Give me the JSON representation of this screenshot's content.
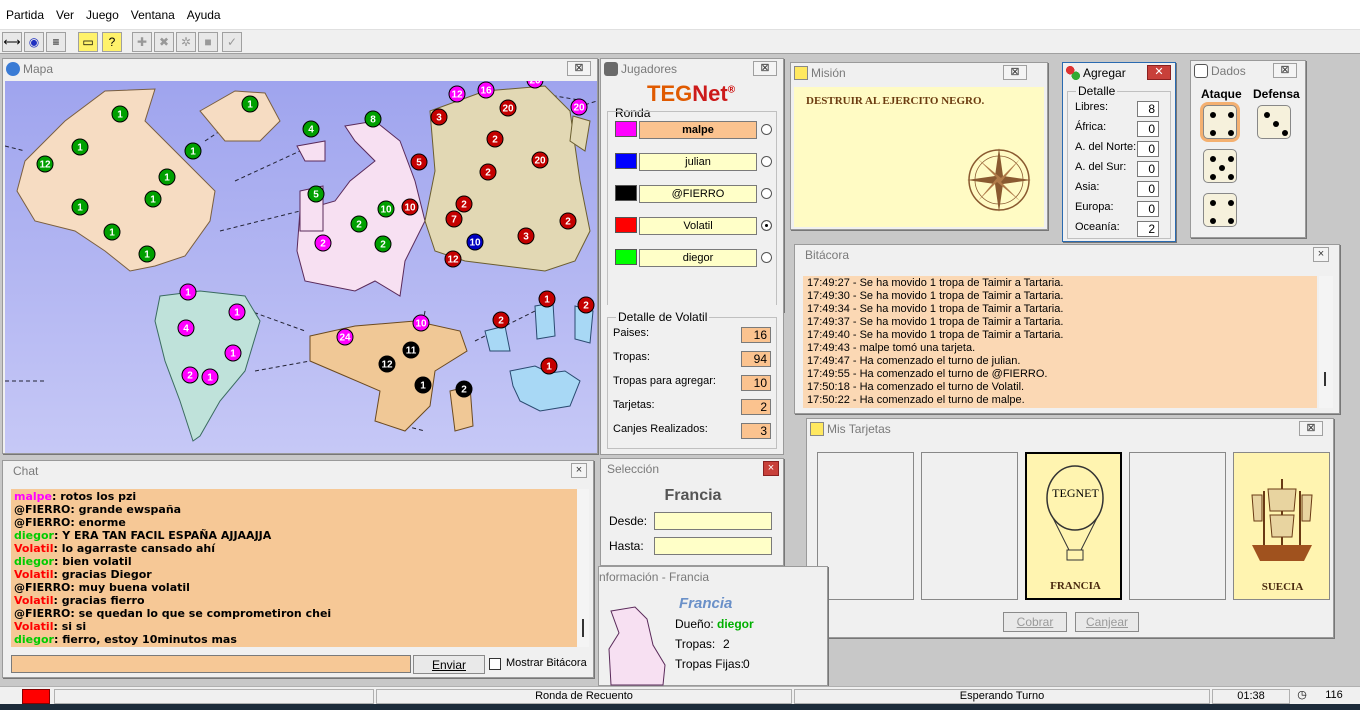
{
  "menu": [
    "Partida",
    "Ver",
    "Juego",
    "Ventana",
    "Ayuda"
  ],
  "toolbar_icons": [
    "connect-icon",
    "globe-icon",
    "list-icon",
    "note-icon",
    "help-icon",
    "plus-icon",
    "cross-icon",
    "gear-icon",
    "block-icon",
    "check-icon"
  ],
  "mapa": {
    "title": "Mapa",
    "close": "⊠"
  },
  "players": {
    "title": "Jugadores",
    "logo_a": "TEG",
    "logo_b": "Net",
    "logo_reg": "®",
    "ronda_label": "Ronda",
    "list": [
      {
        "name": "malpe",
        "color": "#ff00ff",
        "selected": false,
        "active": true
      },
      {
        "name": "julian",
        "color": "#0000ff",
        "selected": false,
        "active": false
      },
      {
        "name": "@FIERRO",
        "color": "#000000",
        "selected": false,
        "active": false
      },
      {
        "name": "Volatil",
        "color": "#ff0000",
        "selected": true,
        "active": false
      },
      {
        "name": "diegor",
        "color": "#00ff00",
        "selected": false,
        "active": false
      }
    ],
    "detail": {
      "title": "Detalle de Volatil",
      "rows": [
        {
          "label": "Paises:",
          "value": "16"
        },
        {
          "label": "Tropas:",
          "value": "94"
        },
        {
          "label": "Tropas para agregar:",
          "value": "10"
        },
        {
          "label": "Tarjetas:",
          "value": "2"
        },
        {
          "label": "Canjes Realizados:",
          "value": "3"
        }
      ]
    }
  },
  "mision": {
    "title": "Misión",
    "text": "DESTRUIR AL EJERCITO NEGRO."
  },
  "agregar": {
    "title": "Agregar",
    "group": "Detalle",
    "rows": [
      {
        "label": "Libres:",
        "value": "8"
      },
      {
        "label": "África:",
        "value": "0"
      },
      {
        "label": "A. del Norte:",
        "value": "0"
      },
      {
        "label": "A. del Sur:",
        "value": "0"
      },
      {
        "label": "Asia:",
        "value": "0"
      },
      {
        "label": "Europa:",
        "value": "0"
      },
      {
        "label": "Oceanía:",
        "value": "2"
      }
    ]
  },
  "dados": {
    "title": "Dados",
    "ataque": "Ataque",
    "defensa": "Defensa",
    "attack": [
      4,
      5,
      4
    ],
    "defense": [
      3
    ]
  },
  "bitacora": {
    "title": "Bitácora",
    "lines": [
      "17:49:27 - Se ha movido 1 tropa de Taimir a Tartaria.",
      "17:49:30 - Se ha movido 1 tropa de Taimir a Tartaria.",
      "17:49:34 - Se ha movido 1 tropa de Taimir a Tartaria.",
      "17:49:37 - Se ha movido 1 tropa de Taimir a Tartaria.",
      "17:49:40 - Se ha movido 1 tropa de Taimir a Tartaria.",
      "17:49:43 - malpe tomó una tarjeta.",
      "17:49:47 - Ha comenzado el turno de julian.",
      "17:49:55 - Ha comenzado el turno de @FIERRO.",
      "17:50:18 - Ha comenzado el turno de Volatil.",
      "17:50:22 - Ha comenzado el turno de malpe."
    ]
  },
  "tarjetas": {
    "title": "Mis Tarjetas",
    "cards": [
      {
        "label": "",
        "filled": false,
        "selected": false
      },
      {
        "label": "",
        "filled": false,
        "selected": false
      },
      {
        "label": "FRANCIA",
        "filled": true,
        "selected": true,
        "logo": "TEGNET",
        "kind": "balloon"
      },
      {
        "label": "",
        "filled": false,
        "selected": false
      },
      {
        "label": "SUECIA",
        "filled": true,
        "selected": false,
        "kind": "ship"
      }
    ],
    "cobrar": "Cobrar",
    "canjear": "Canjear"
  },
  "chat": {
    "title": "Chat",
    "messages": [
      {
        "user": "malpe",
        "color": "#ff00ff",
        "text": "rotos los pzi"
      },
      {
        "user": "@FIERRO",
        "color": "#000000",
        "text": "grande ewspaña"
      },
      {
        "user": "@FIERRO",
        "color": "#000000",
        "text": "enorme"
      },
      {
        "user": "diegor",
        "color": "#00cc00",
        "text": "Y ERA TAN FACIL ESPAÑA AJJAAJJA"
      },
      {
        "user": "Volatil",
        "color": "#ff0000",
        "text": "lo agarraste cansado ahí"
      },
      {
        "user": "diegor",
        "color": "#00cc00",
        "text": "bien volatil"
      },
      {
        "user": "Volatil",
        "color": "#ff0000",
        "text": "gracias Diegor"
      },
      {
        "user": "@FIERRO",
        "color": "#000000",
        "text": "muy buena volatil"
      },
      {
        "user": "Volatil",
        "color": "#ff0000",
        "text": "gracias fierro"
      },
      {
        "user": "@FIERRO",
        "color": "#000000",
        "text": "se quedan lo que se comprometiron chei"
      },
      {
        "user": "Volatil",
        "color": "#ff0000",
        "text": "si si"
      },
      {
        "user": "diegor",
        "color": "#00cc00",
        "text": "fierro, estoy 10minutos mas"
      }
    ],
    "send": "Enviar",
    "show_log": "Mostrar Bitácora",
    "input_value": ""
  },
  "seleccion": {
    "title": "Selección",
    "country": "Francia",
    "desde": "Desde:",
    "hasta": "Hasta:"
  },
  "info": {
    "title": "nformación - Francia",
    "country": "Francia",
    "owner_label": "Dueño:",
    "owner": "diegor",
    "tropas_label": "Tropas:",
    "tropas": "2",
    "fijas_label": "Tropas Fijas:",
    "fijas": "0"
  },
  "status": {
    "center": "Ronda de Recuento",
    "turn": "Esperando Turno",
    "time": "01:38",
    "count": "116"
  },
  "colors": {
    "magenta": "#ff00ff",
    "green": "#00aa00",
    "red": "#c40000",
    "blue": "#0000cc",
    "black": "#000000",
    "ocean": "#a8a8f0",
    "panel_orange": "#f6c48c"
  },
  "map_markers": [
    {
      "t": "1",
      "c": "green"
    },
    {
      "t": "1",
      "c": "green"
    },
    {
      "t": "12",
      "c": "green"
    },
    {
      "t": "1",
      "c": "green"
    },
    {
      "t": "1",
      "c": "green"
    },
    {
      "t": "1",
      "c": "green"
    },
    {
      "t": "1",
      "c": "green"
    },
    {
      "t": "1",
      "c": "green"
    },
    {
      "t": "1",
      "c": "green"
    },
    {
      "t": "1",
      "c": "green"
    },
    {
      "t": "4",
      "c": "green"
    },
    {
      "t": "8",
      "c": "green"
    },
    {
      "t": "5",
      "c": "green"
    },
    {
      "t": "2",
      "c": "green"
    },
    {
      "t": "10",
      "c": "green"
    },
    {
      "t": "2",
      "c": "green"
    },
    {
      "t": "1",
      "c": "magenta"
    },
    {
      "t": "1",
      "c": "magenta"
    },
    {
      "t": "4",
      "c": "magenta"
    },
    {
      "t": "1",
      "c": "magenta"
    },
    {
      "t": "2",
      "c": "magenta"
    },
    {
      "t": "1",
      "c": "magenta"
    },
    {
      "t": "2",
      "c": "magenta"
    },
    {
      "t": "24",
      "c": "magenta"
    },
    {
      "t": "10",
      "c": "magenta"
    },
    {
      "t": "12",
      "c": "magenta"
    },
    {
      "t": "16",
      "c": "magenta"
    },
    {
      "t": "20",
      "c": "magenta"
    },
    {
      "t": "20",
      "c": "magenta"
    },
    {
      "t": "3",
      "c": "red"
    },
    {
      "t": "2",
      "c": "red"
    },
    {
      "t": "20",
      "c": "red"
    },
    {
      "t": "5",
      "c": "red"
    },
    {
      "t": "2",
      "c": "red"
    },
    {
      "t": "2",
      "c": "red"
    },
    {
      "t": "20",
      "c": "red"
    },
    {
      "t": "10",
      "c": "red"
    },
    {
      "t": "7",
      "c": "red"
    },
    {
      "t": "12",
      "c": "red"
    },
    {
      "t": "3",
      "c": "red"
    },
    {
      "t": "2",
      "c": "red"
    },
    {
      "t": "2",
      "c": "red"
    },
    {
      "t": "1",
      "c": "red"
    },
    {
      "t": "2",
      "c": "red"
    },
    {
      "t": "1",
      "c": "red"
    },
    {
      "t": "10",
      "c": "blue"
    },
    {
      "t": "12",
      "c": "black"
    },
    {
      "t": "11",
      "c": "black"
    },
    {
      "t": "1",
      "c": "black"
    },
    {
      "t": "2",
      "c": "black"
    }
  ]
}
